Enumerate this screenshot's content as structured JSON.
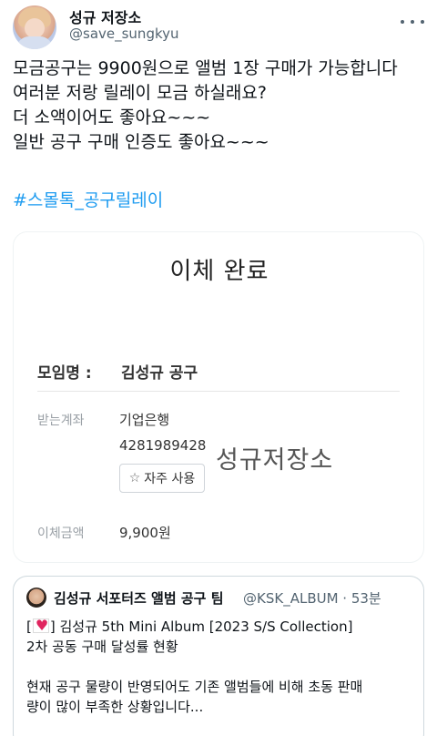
{
  "author": {
    "name": "성규 저장소",
    "handle": "@save_sungkyu"
  },
  "tweet": {
    "lines": [
      "모금공구는 9900원으로 앨범 1장 구매가 가능합니다",
      "여러분 저랑 릴레이 모금 하실래요?",
      "더 소액이어도 좋아요~~~",
      "일반 공구 구매 인증도 좋아요~~~"
    ],
    "hashtag": "#스몰톡_공구릴레이"
  },
  "receipt": {
    "title": "이체 완료",
    "group_label": "모임명 :",
    "group_value": "김성규  공구",
    "account_label": "받는계좌",
    "bank": "기업은행",
    "account_number": "4281989428",
    "favorite_label": "자주 사용",
    "amount_label": "이체금액",
    "amount": "9,900원",
    "stamp": "성규저장소"
  },
  "quote": {
    "name": "김성규 서포터즈 앨범 공구 팀",
    "handle": "@KSK_ALBUM · 53분",
    "line1_rest": " 김성규 5th Mini Album [2023 S/S Collection]",
    "line1_prefix": "[",
    "line1_suffix": "]",
    "line2": "2차 공동 구매 달성률 현황",
    "line3": "현재 공구 물량이 반영되어도 기존 앨범들에 비해 초동 판매",
    "line4": "량이 많이 부족한 상황입니다..."
  },
  "colors": {
    "link": "#1d9bf0",
    "secondary_text": "#536471",
    "heart": "#e0245e"
  },
  "icons": [
    "more-icon",
    "star-icon",
    "heart-icon"
  ]
}
